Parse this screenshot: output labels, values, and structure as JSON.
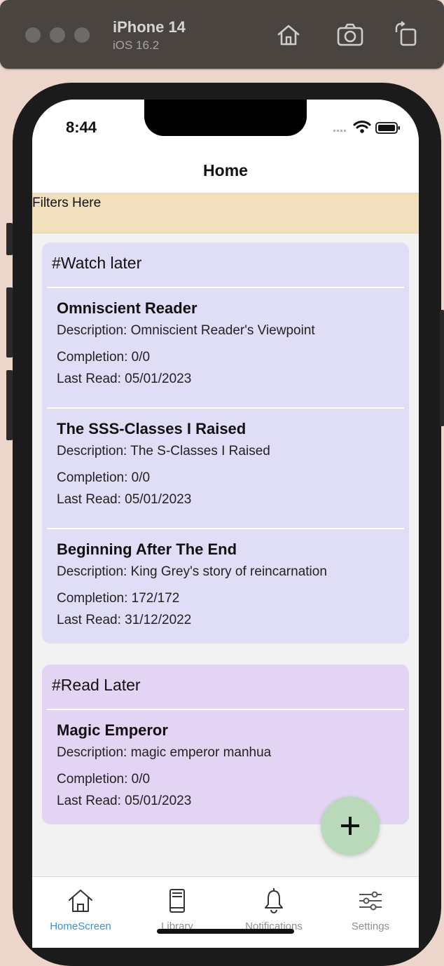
{
  "simulator": {
    "device_name": "iPhone 14",
    "os_version": "iOS 16.2"
  },
  "status_bar": {
    "time": "8:44"
  },
  "nav": {
    "title": "Home"
  },
  "filters": {
    "label": "Filters Here"
  },
  "groups": [
    {
      "title": "#Watch later",
      "items": [
        {
          "title": "Omniscient Reader",
          "description": "Description: Omniscient Reader's Viewpoint",
          "completion": "Completion: 0/0",
          "last_read": "Last Read: 05/01/2023"
        },
        {
          "title": "The SSS-Classes I Raised",
          "description": "Description: The S-Classes I Raised",
          "completion": "Completion: 0/0",
          "last_read": "Last Read: 05/01/2023"
        },
        {
          "title": "Beginning After The End",
          "description": "Description: King Grey's story of reincarnation",
          "completion": "Completion: 172/172",
          "last_read": "Last Read: 31/12/2022"
        }
      ]
    },
    {
      "title": "#Read Later",
      "items": [
        {
          "title": "Magic Emperor",
          "description": "Description: magic emperor manhua",
          "completion": "Completion: 0/0",
          "last_read": "Last Read: 05/01/2023"
        }
      ]
    }
  ],
  "fab": {
    "icon": "plus-icon"
  },
  "tabs": [
    {
      "label": "HomeScreen",
      "icon": "home-icon",
      "active": true
    },
    {
      "label": "Library",
      "icon": "book-icon",
      "active": false
    },
    {
      "label": "Notifications",
      "icon": "bell-icon",
      "active": false
    },
    {
      "label": "Settings",
      "icon": "sliders-icon",
      "active": false
    }
  ],
  "colors": {
    "watch_later_bg": "#e0ddf7",
    "read_later_bg": "#e3d4f4",
    "filters_bg": "#f2dfbd",
    "fab_bg": "#b9d9ba",
    "active_tab": "#3b8fd6"
  }
}
